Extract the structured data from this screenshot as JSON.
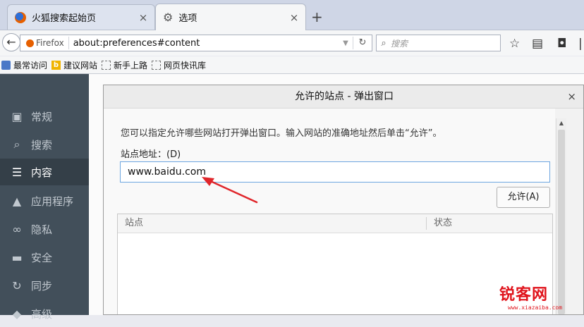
{
  "tabs": [
    {
      "label": "火狐搜索起始页",
      "icon": "firefox-icon"
    },
    {
      "label": "选项",
      "icon": "gear-icon"
    }
  ],
  "navbar": {
    "identity_label": "Firefox",
    "url": "about:preferences#content",
    "search_placeholder": "搜索"
  },
  "bookmarks": [
    {
      "label": "最常访问",
      "icon": "folder-icon"
    },
    {
      "label": "建议网站",
      "icon": "bing-icon"
    },
    {
      "label": "新手上路",
      "icon": "bookmark-icon"
    },
    {
      "label": "网页快讯库",
      "icon": "bookmark-icon"
    }
  ],
  "sidebar": {
    "items": [
      {
        "label": "常规",
        "icon": "general-icon"
      },
      {
        "label": "搜索",
        "icon": "search-icon"
      },
      {
        "label": "内容",
        "icon": "content-icon",
        "active": true
      },
      {
        "label": "应用程序",
        "icon": "rocket-icon"
      },
      {
        "label": "隐私",
        "icon": "mask-icon"
      },
      {
        "label": "安全",
        "icon": "security-icon"
      },
      {
        "label": "同步",
        "icon": "sync-icon"
      },
      {
        "label": "高级",
        "icon": "advanced-icon"
      }
    ]
  },
  "dialog": {
    "title": "允许的站点 - 弹出窗口",
    "intro": "您可以指定允许哪些网站打开弹出窗口。输入网站的准确地址然后单击“允许”。",
    "address_label": "站点地址：(D)",
    "address_value": "www.baidu.com",
    "allow_button": "允许(A)",
    "table_headers": [
      "站点",
      "状态"
    ]
  },
  "watermark": {
    "main": "锐客网",
    "sub": "www.xiazaiba.com"
  },
  "colors": {
    "sidebar_bg": "#424f5a",
    "arrow": "#e0262b",
    "watermark": "#e0141c"
  }
}
